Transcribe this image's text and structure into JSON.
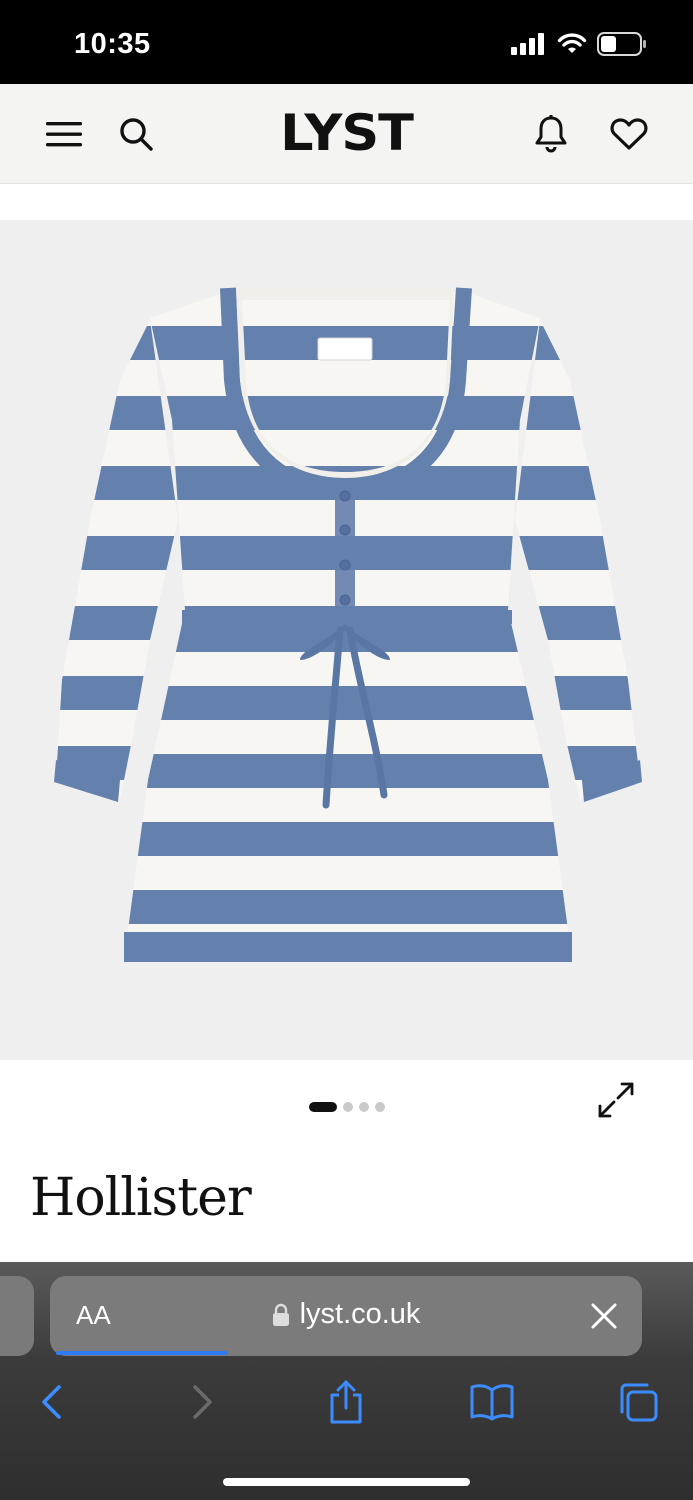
{
  "status_bar": {
    "time": "10:35",
    "icons": [
      "signal-icon",
      "wifi-icon",
      "battery-icon"
    ]
  },
  "header": {
    "logo": "LYST",
    "icons": [
      "menu-icon",
      "search-icon",
      "bell-icon",
      "heart-icon"
    ]
  },
  "product": {
    "image_alt_subject": "striped knit dress",
    "carousel": {
      "count": 4,
      "active_index": 0
    },
    "brand": "Hollister"
  },
  "browser": {
    "text_size_label": "AA",
    "url": "lyst.co.uk",
    "load_progress": 0.29,
    "toolbar_icons": [
      "back-icon",
      "forward-icon",
      "share-icon",
      "bookmarks-icon",
      "tabs-icon"
    ]
  },
  "colors": {
    "stripe_blue": "#6480ad",
    "stripe_white": "#f7f6f2",
    "accent_blue": "#2f7cf6"
  }
}
